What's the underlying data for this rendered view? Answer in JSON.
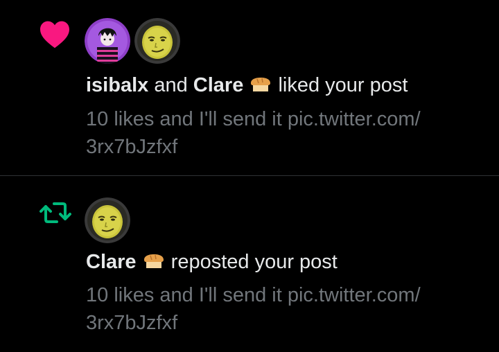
{
  "notifications": [
    {
      "type": "like",
      "icon": "heart-icon",
      "accent": "#f91880",
      "avatars": [
        "isibalx-avatar",
        "clare-avatar"
      ],
      "actor1": "isibalx",
      "connector": " and ",
      "actor2": "Clare",
      "emoji": "bread-icon",
      "action": " liked your post",
      "post_line1": "10 likes and I'll send it pic.twitter.com/",
      "post_line2": "3rx7bJzfxf"
    },
    {
      "type": "repost",
      "icon": "repost-icon",
      "accent": "#00ba7c",
      "avatars": [
        "clare-avatar"
      ],
      "actor1": "Clare",
      "emoji": "bread-icon",
      "action": " reposted your post",
      "post_line1": "10 likes and I'll send it pic.twitter.com/",
      "post_line2": "3rx7bJzfxf"
    }
  ],
  "colors": {
    "background": "#000000",
    "text_primary": "#e7e9ea",
    "text_secondary": "#71767b",
    "divider": "#2f3336"
  }
}
